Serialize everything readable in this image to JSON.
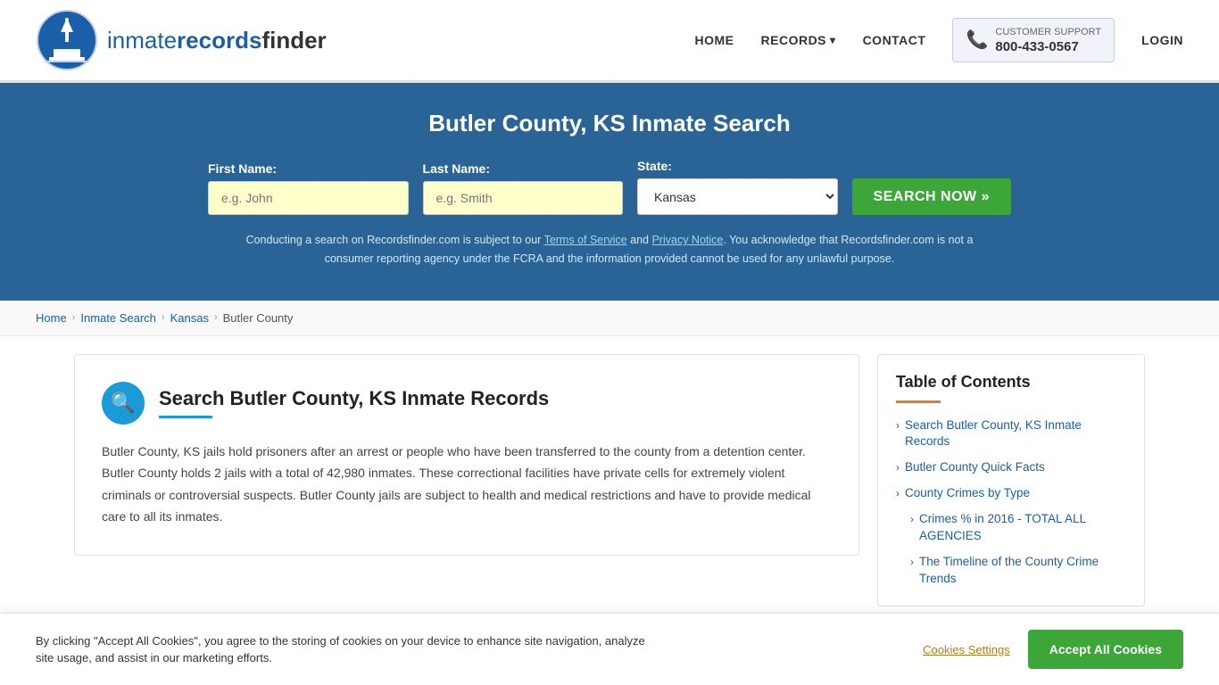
{
  "header": {
    "logo_text_inmate": "inmate",
    "logo_text_records": "records",
    "logo_text_finder": "finder",
    "nav": {
      "home": "HOME",
      "records": "RECORDS",
      "contact": "CONTACT",
      "login": "LOGIN",
      "support_label": "CUSTOMER SUPPORT",
      "support_number": "800-433-0567"
    }
  },
  "search_banner": {
    "title": "Butler County, KS Inmate Search",
    "first_name_label": "First Name:",
    "first_name_placeholder": "e.g. John",
    "last_name_label": "Last Name:",
    "last_name_placeholder": "e.g. Smith",
    "state_label": "State:",
    "state_value": "Kansas",
    "search_button": "SEARCH NOW »",
    "disclaimer": "Conducting a search on Recordsfinder.com is subject to our Terms of Service and Privacy Notice. You acknowledge that Recordsfinder.com is not a consumer reporting agency under the FCRA and the information provided cannot be used for any unlawful purpose."
  },
  "breadcrumb": {
    "home": "Home",
    "inmate_search": "Inmate Search",
    "state": "Kansas",
    "county": "Butler County"
  },
  "main": {
    "section_title": "Search Butler County, KS Inmate Records",
    "section_text": "Butler County, KS jails hold prisoners after an arrest or people who have been transferred to the county from a detention center. Butler County holds 2 jails with a total of 42,980 inmates. These correctional facilities have private cells for extremely violent criminals or controversial suspects. Butler County jails are subject to health and medical restrictions and have to provide medical care to all its inmates."
  },
  "toc": {
    "title": "Table of Contents",
    "items": [
      {
        "label": "Search Butler County, KS Inmate Records",
        "sub": false
      },
      {
        "label": "Butler County Quick Facts",
        "sub": false
      },
      {
        "label": "County Crimes by Type",
        "sub": false
      },
      {
        "label": "Crimes % in 2016 - TOTAL ALL AGENCIES",
        "sub": true
      },
      {
        "label": "The Timeline of the County Crime Trends",
        "sub": true
      }
    ]
  },
  "cookie_banner": {
    "text": "By clicking \"Accept All Cookies\", you agree to the storing of cookies on your device to enhance site navigation, analyze site usage, and assist in our marketing efforts.",
    "settings_btn": "Cookies Settings",
    "accept_btn": "Accept All Cookies"
  },
  "icons": {
    "search": "🔍",
    "phone": "📞",
    "chevron_right": "›",
    "chevron_down": "▾"
  }
}
